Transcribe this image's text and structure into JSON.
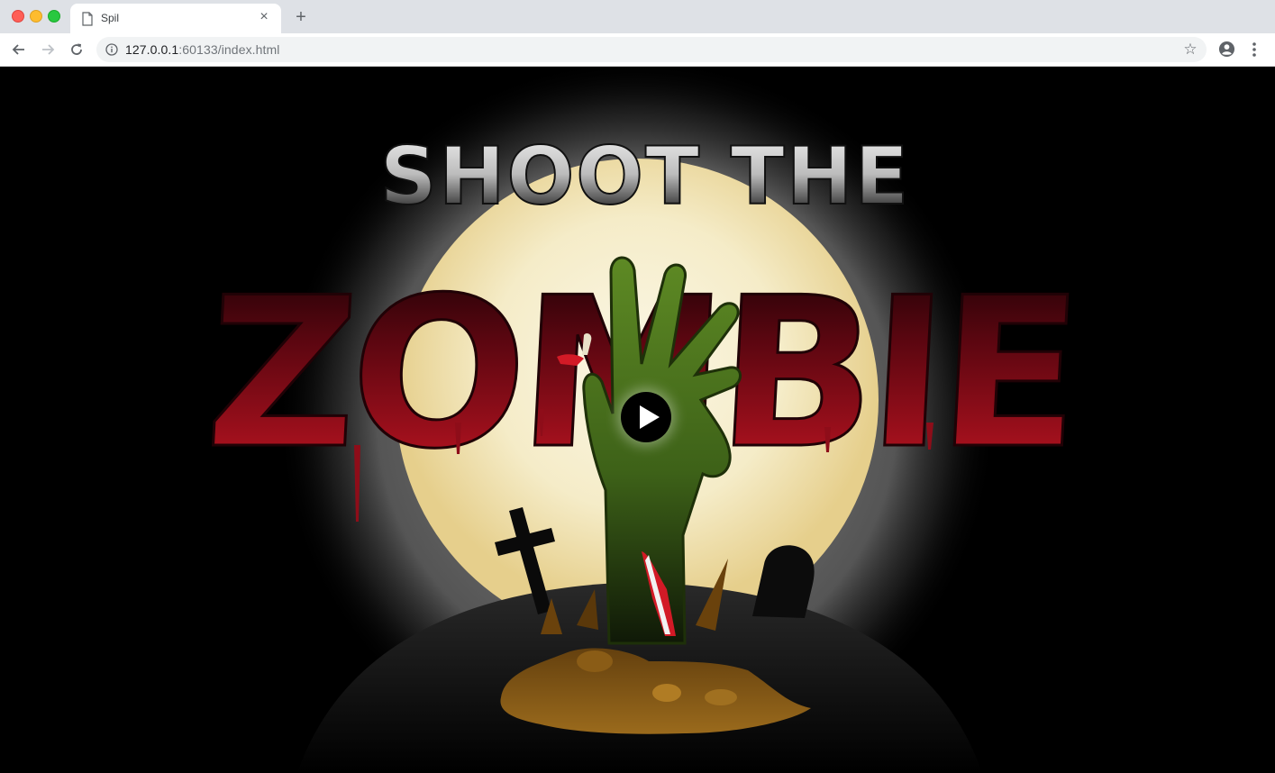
{
  "browser": {
    "tab_title": "Spil",
    "url_host": "127.0.0.1",
    "url_rest": ":60133/index.html",
    "close_glyph": "×",
    "new_tab_glyph": "+",
    "icons": [
      "page-icon",
      "back-icon",
      "forward-icon",
      "reload-icon",
      "info-icon",
      "star-icon",
      "profile-icon",
      "menu-icon"
    ]
  },
  "game": {
    "title_line1": "SHOOT THE",
    "title_line2": "ZOMBIE",
    "colors": {
      "moon": "#f7f1d8",
      "moon_edge": "#e8cf8f",
      "title_red_top": "#1a0204",
      "title_red_bottom": "#a0101e",
      "hand_green": "#4f7a1e",
      "dirt": "#7a4a0e"
    },
    "icons": [
      "play-icon",
      "cross-gravestone",
      "round-gravestone",
      "zombie-hand"
    ]
  }
}
